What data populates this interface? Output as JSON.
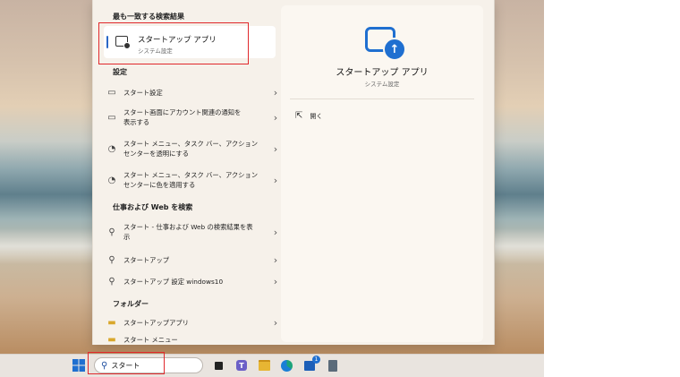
{
  "best_match": {
    "heading": "最も一致する検索結果",
    "title": "スタートアップ アプリ",
    "subtitle": "システム設定"
  },
  "settings": {
    "heading": "設定",
    "items": [
      {
        "label_line1": "スタート設定",
        "label_line2": ""
      },
      {
        "label_line1": "スタート画面にアカウント関連の通知を",
        "label_line2": "表示する"
      },
      {
        "label_line1": "スタート メニュー、タスク バー、アクション",
        "label_line2": "センターを透明にする"
      },
      {
        "label_line1": "スタート メニュー、タスク バー、アクション",
        "label_line2": "センターに色を適用する"
      }
    ]
  },
  "web": {
    "heading": "仕事および Web を検索",
    "items": [
      {
        "label_line1": "スタート - 仕事および Web の検索結果を表",
        "label_line2": "示"
      },
      {
        "label_line1": "スタートアップ",
        "label_line2": ""
      },
      {
        "label_line1": "スタートアップ 設定 windows10",
        "label_line2": ""
      }
    ]
  },
  "folders": {
    "heading": "フォルダー",
    "items": [
      {
        "label": "スタートアップアプリ"
      },
      {
        "label": "スタート メニュー"
      }
    ]
  },
  "preview": {
    "title": "スタートアップ アプリ",
    "subtitle": "システム設定",
    "open_label": "開く"
  },
  "taskbar": {
    "search_value": "スタート",
    "store_badge": "1"
  },
  "colors": {
    "accent": "#1f6fd0",
    "highlight": "#e0282c"
  }
}
